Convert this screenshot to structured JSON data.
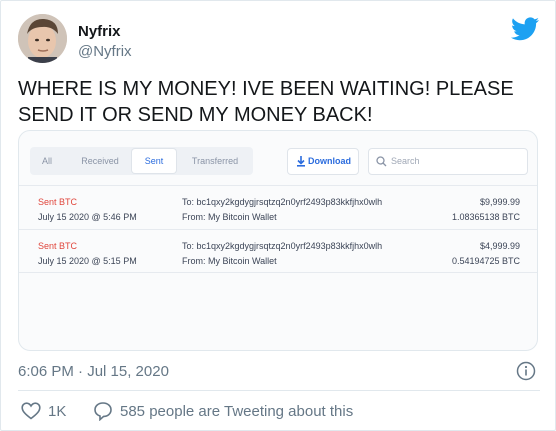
{
  "author": {
    "display_name": "Nyfrix",
    "handle": "@Nyfrix"
  },
  "tweet": {
    "text": "WHERE IS MY MONEY! IVE BEEN WAITING! PLEASE SEND IT OR SEND MY MONEY BACK!",
    "timestamp": "6:06 PM · Jul 15, 2020",
    "likes": "1K",
    "tweeting_text": "585 people are Tweeting about this"
  },
  "wallet": {
    "tabs": [
      {
        "label": "All",
        "active": false
      },
      {
        "label": "Received",
        "active": false
      },
      {
        "label": "Sent",
        "active": true
      },
      {
        "label": "Transferred",
        "active": false
      }
    ],
    "download_label": "Download",
    "search_placeholder": "Search",
    "transactions": [
      {
        "type": "Sent BTC",
        "date": "July 15 2020 @ 5:46 PM",
        "to": "To: bc1qxy2kgdygjrsqtzq2n0yrf2493p83kkfjhx0wlh",
        "from": "From: My Bitcoin Wallet",
        "usd": "$9,999.99",
        "btc": "1.08365138 BTC"
      },
      {
        "type": "Sent BTC",
        "date": "July 15 2020 @ 5:15 PM",
        "to": "To: bc1qxy2kgdygjrsqtzq2n0yrf2493p83kkfjhx0wlh",
        "from": "From: My Bitcoin Wallet",
        "usd": "$4,999.99",
        "btc": "0.54194725 BTC"
      }
    ]
  },
  "colors": {
    "twitter_blue": "#1da1f2",
    "sent_red": "#e0463c",
    "wallet_accent": "#2b6cde",
    "muted_text": "#657786"
  },
  "icons": [
    "twitter-logo-icon",
    "download-icon",
    "search-icon",
    "info-icon",
    "heart-icon",
    "speech-bubble-icon"
  ]
}
